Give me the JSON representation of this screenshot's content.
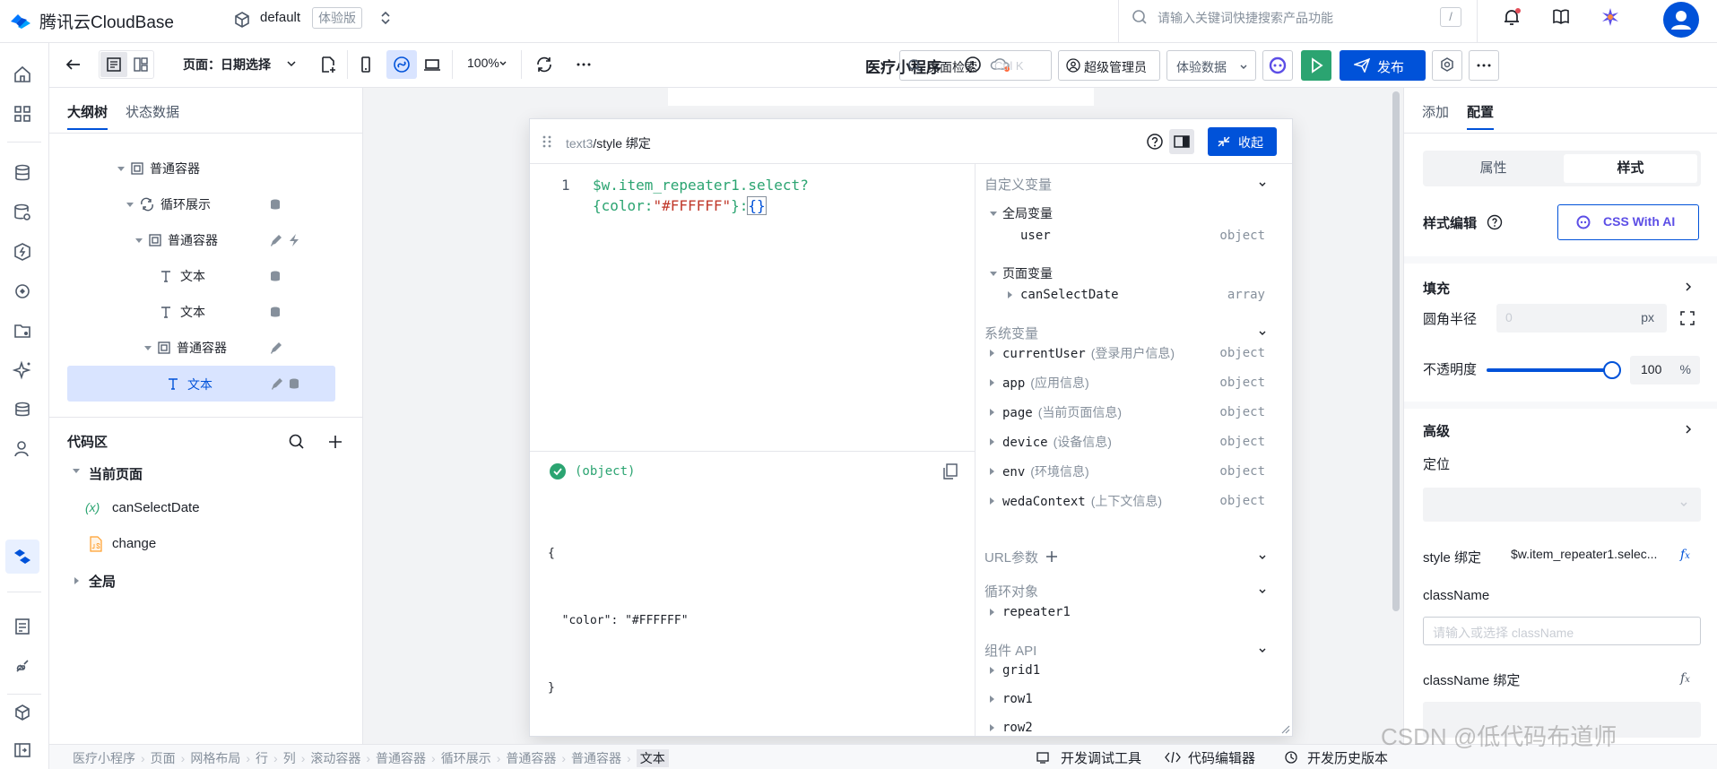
{
  "topbar": {
    "brand": "腾讯云CloudBase",
    "env_name": "default",
    "env_badge": "体验版",
    "search_placeholder": "请输入关键词快捷搜索产品功能",
    "search_shortcut": "/"
  },
  "toolbar": {
    "page_label": "页面：日期选择",
    "zoom": "100%",
    "app_title": "医疗小程序",
    "page_search": "页面检索",
    "page_search_shortcut": "Ctrl K",
    "admin_label": "超级管理员",
    "data_mode": "体验数据",
    "publish_label": "发布"
  },
  "left_panel": {
    "tabs": [
      "大纲树",
      "状态数据"
    ],
    "tree": [
      {
        "label": "普通容器",
        "type": "container",
        "indent": 2
      },
      {
        "label": "循环展示",
        "type": "loop",
        "indent": 3
      },
      {
        "label": "普通容器",
        "type": "container",
        "indent": 4
      },
      {
        "label": "文本",
        "type": "text",
        "indent": 5
      },
      {
        "label": "文本",
        "type": "text",
        "indent": 5
      },
      {
        "label": "普通容器",
        "type": "container",
        "indent": 5
      },
      {
        "label": "文本",
        "type": "text",
        "indent": 6,
        "selected": true
      }
    ],
    "code_title": "代码区",
    "current_page": "当前页面",
    "code_items": [
      {
        "label": "canSelectDate",
        "kind": "variable",
        "icon_text": "(x)"
      },
      {
        "label": "change",
        "kind": "js-file",
        "icon_text": ""
      }
    ],
    "global_label": "全局"
  },
  "editor": {
    "breadcrumb_prefix": "text3",
    "breadcrumb_current": "/style 绑定",
    "collapse_label": "收起",
    "line_number": "1",
    "code_line1": "$w.item_repeater1.select?",
    "code_line2_a": "{color:",
    "code_line2_str": "\"#FFFFFF\"",
    "code_line2_b": "}:",
    "code_line2_c": "{}",
    "result_type": "(object)",
    "result_lines": [
      "{",
      "  \"color\": \"#FFFFFF\"",
      "}"
    ]
  },
  "variables": {
    "custom_title": "自定义变量",
    "global_title": "全局变量",
    "global_items": [
      {
        "name": "user",
        "type": "object"
      }
    ],
    "page_title": "页面变量",
    "page_items": [
      {
        "name": "canSelectDate",
        "type": "array"
      }
    ],
    "system_title": "系统变量",
    "system_items": [
      {
        "name": "currentUser",
        "desc": "(登录用户信息)",
        "type": "object"
      },
      {
        "name": "app",
        "desc": "(应用信息)",
        "type": "object"
      },
      {
        "name": "page",
        "desc": "(当前页面信息)",
        "type": "object"
      },
      {
        "name": "device",
        "desc": "(设备信息)",
        "type": "object"
      },
      {
        "name": "env",
        "desc": "(环境信息)",
        "type": "object"
      },
      {
        "name": "wedaContext",
        "desc": "(上下文信息)",
        "type": "object"
      }
    ],
    "url_title": "URL参数",
    "loop_title": "循环对象",
    "loop_items": [
      {
        "name": "repeater1"
      }
    ],
    "api_title": "组件 API",
    "api_items": [
      {
        "name": "grid1"
      },
      {
        "name": "row1"
      },
      {
        "name": "row2"
      }
    ]
  },
  "right_panel": {
    "tabs": [
      "添加",
      "配置"
    ],
    "segment": [
      "属性",
      "样式"
    ],
    "style_edit_label": "样式编辑",
    "css_ai_label": "CSS With AI",
    "fill_label": "填充",
    "radius_label": "圆角半径",
    "radius_placeholder": "0",
    "radius_unit": "px",
    "opacity_label": "不透明度",
    "opacity_value": "100",
    "opacity_unit": "%",
    "opacity_fraction": 1.0,
    "advanced_label": "高级",
    "position_label": "定位",
    "style_binding_label": "style 绑定",
    "style_binding_value": "$w.item_repeater1.selec...",
    "classname_label": "className",
    "classname_placeholder": "请输入或选择 className",
    "classname_binding_label": "className 绑定"
  },
  "bottom_bar": {
    "breadcrumbs": [
      "医疗小程序",
      "页面",
      "网格布局",
      "行",
      "列",
      "滚动容器",
      "普通容器",
      "循环展示",
      "普通容器",
      "普通容器",
      "文本"
    ],
    "tools": [
      "开发调试工具",
      "代码编辑器",
      "开发历史版本"
    ]
  },
  "watermark": "CSDN @低代码布道师",
  "colors": {
    "primary": "#0052d9",
    "green": "#2ba471",
    "purple": "#5c4ee6",
    "selected_bg": "#d9e4ff"
  }
}
